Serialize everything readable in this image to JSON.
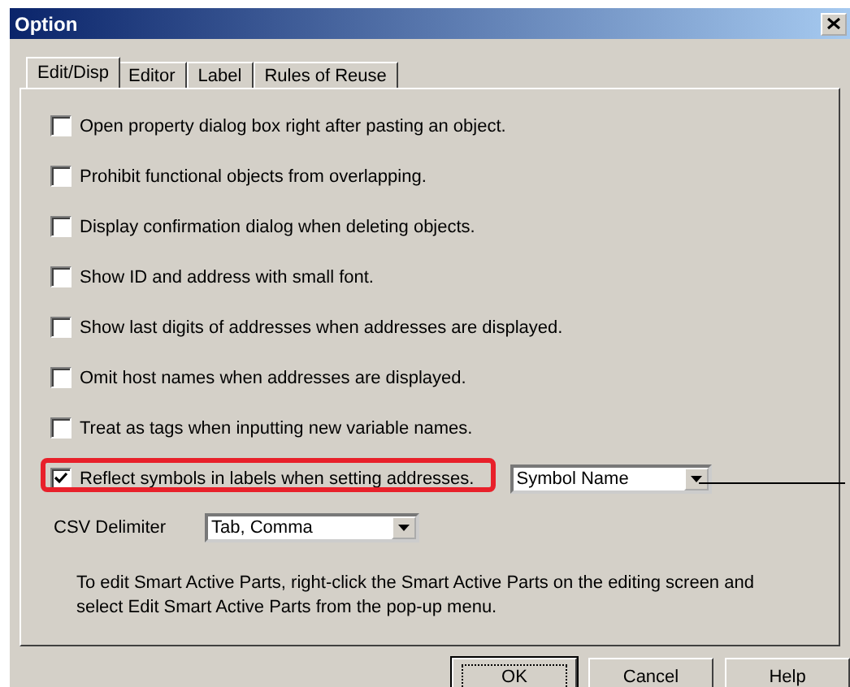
{
  "window": {
    "title": "Option"
  },
  "tabs": [
    {
      "label": "Edit/Disp",
      "selected": true
    },
    {
      "label": "Editor",
      "selected": false
    },
    {
      "label": "Label",
      "selected": false
    },
    {
      "label": "Rules of Reuse",
      "selected": false
    }
  ],
  "options": [
    {
      "label": "Open property dialog box right after pasting an object.",
      "checked": false,
      "highlighted": false
    },
    {
      "label": "Prohibit functional objects from overlapping.",
      "checked": false,
      "highlighted": false
    },
    {
      "label": "Display confirmation dialog when deleting objects.",
      "checked": false,
      "highlighted": false
    },
    {
      "label": "Show ID and address with small font.",
      "checked": false,
      "highlighted": false
    },
    {
      "label": "Show last digits of addresses when addresses are displayed.",
      "checked": false,
      "highlighted": false
    },
    {
      "label": "Omit host names when addresses are displayed.",
      "checked": false,
      "highlighted": false
    },
    {
      "label": "Treat as tags when inputting new variable names.",
      "checked": false,
      "highlighted": false
    },
    {
      "label": "Reflect symbols in labels when setting addresses.",
      "checked": true,
      "highlighted": true,
      "dropdown": "Symbol Name"
    }
  ],
  "csv_delimiter": {
    "label": "CSV Delimiter",
    "value": "Tab, Comma"
  },
  "note": "To edit Smart Active Parts, right-click the Smart Active Parts on the editing screen and select Edit Smart Active Parts from the pop-up menu.",
  "buttons": [
    {
      "label": "OK",
      "default": true
    },
    {
      "label": "Cancel",
      "default": false
    },
    {
      "label": "Help",
      "default": false
    }
  ]
}
